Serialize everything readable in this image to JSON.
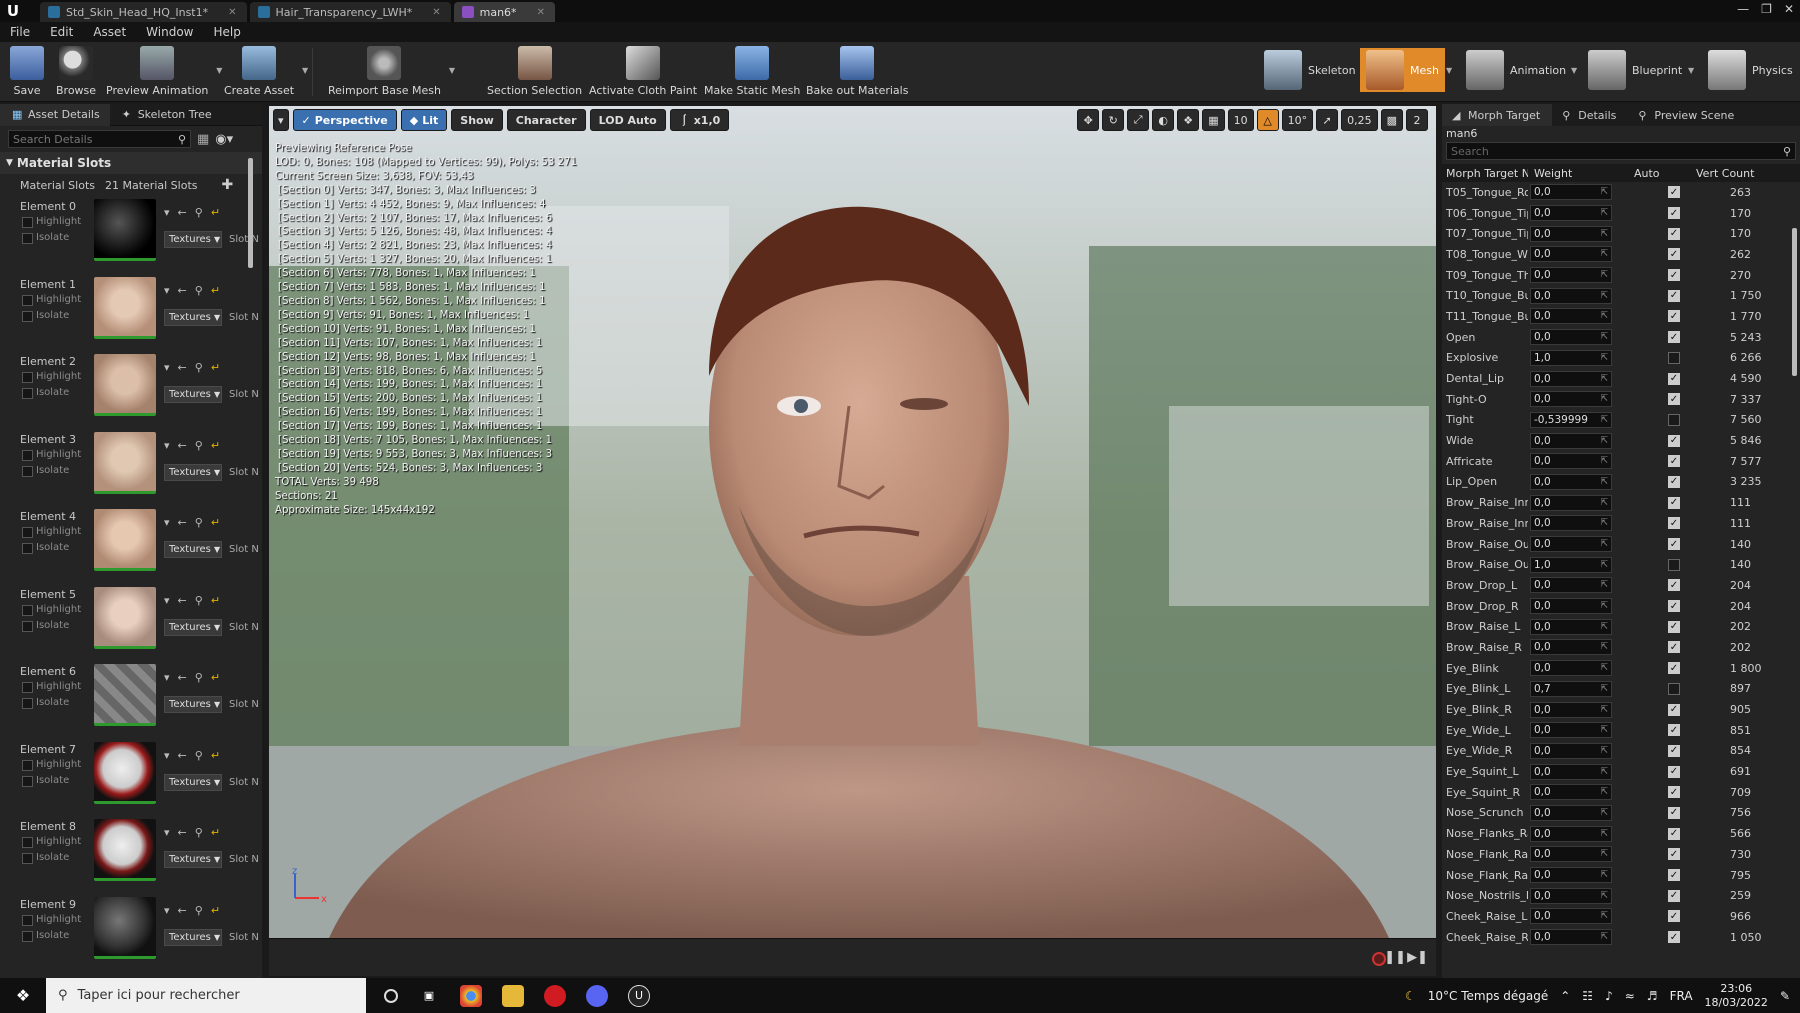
{
  "tabs": [
    {
      "label": "Std_Skin_Head_HQ_Inst1*",
      "active": false
    },
    {
      "label": "Hair_Transparency_LWH*",
      "active": false
    },
    {
      "label": "man6*",
      "active": true
    }
  ],
  "menu": [
    "File",
    "Edit",
    "Asset",
    "Window",
    "Help"
  ],
  "toolbar": {
    "save": "Save",
    "browse": "Browse",
    "preview_animation": "Preview Animation",
    "create_asset": "Create Asset",
    "reimport": "Reimport Base Mesh",
    "section_selection": "Section Selection",
    "cloth_paint": "Activate Cloth Paint",
    "make_static": "Make Static Mesh",
    "bake_out": "Bake out Materials"
  },
  "modes": {
    "skeleton": "Skeleton",
    "mesh": "Mesh",
    "animation": "Animation",
    "blueprint": "Blueprint",
    "physics": "Physics"
  },
  "left": {
    "tab_asset_details": "Asset Details",
    "tab_skeleton_tree": "Skeleton Tree",
    "search_placeholder": "Search Details",
    "section_title": "Material Slots",
    "slots_label": "Material Slots",
    "slots_count": "21 Material Slots",
    "highlight": "Highlight",
    "isolate": "Isolate",
    "textures": "Textures",
    "slot_name": "Slot N",
    "elements": [
      "Element 0",
      "Element 1",
      "Element 2",
      "Element 3",
      "Element 4",
      "Element 5",
      "Element 6",
      "Element 7",
      "Element 8",
      "Element 9"
    ]
  },
  "viewport": {
    "perspective": "Perspective",
    "lit": "Lit",
    "show": "Show",
    "character": "Character",
    "lod": "LOD Auto",
    "speed": "x1,0",
    "grid": "10",
    "angle": "10°",
    "scale": "0,25",
    "cams": "2",
    "stats": [
      "Previewing Reference Pose",
      "LOD: 0, Bones: 108 (Mapped to Vertices: 99), Polys: 53 271",
      "Current Screen Size: 3,638, FOV: 53,43",
      "[Section 0] Verts: 347, Bones: 3, Max Influences: 3",
      "[Section 1] Verts: 4 452, Bones: 9, Max Influences: 4",
      "[Section 2] Verts: 2 107, Bones: 17, Max Influences: 6",
      "[Section 3] Verts: 5 126, Bones: 48, Max Influences: 4",
      "[Section 4] Verts: 2 821, Bones: 23, Max Influences: 4",
      "[Section 5] Verts: 1 327, Bones: 20, Max Influences: 1",
      "[Section 6] Verts: 778, Bones: 1, Max Influences: 1",
      "[Section 7] Verts: 1 583, Bones: 1, Max Influences: 1",
      "[Section 8] Verts: 1 562, Bones: 1, Max Influences: 1",
      "[Section 9] Verts: 91, Bones: 1, Max Influences: 1",
      "[Section 10] Verts: 91, Bones: 1, Max Influences: 1",
      "[Section 11] Verts: 107, Bones: 1, Max Influences: 1",
      "[Section 12] Verts: 98, Bones: 1, Max Influences: 1",
      "[Section 13] Verts: 818, Bones: 6, Max Influences: 5",
      "[Section 14] Verts: 199, Bones: 1, Max Influences: 1",
      "[Section 15] Verts: 200, Bones: 1, Max Influences: 1",
      "[Section 16] Verts: 199, Bones: 1, Max Influences: 1",
      "[Section 17] Verts: 199, Bones: 1, Max Influences: 1",
      "[Section 18] Verts: 7 105, Bones: 1, Max Influences: 1",
      "[Section 19] Verts: 9 553, Bones: 3, Max Influences: 3",
      "[Section 20] Verts: 524, Bones: 3, Max Influences: 3",
      "TOTAL Verts: 39 498",
      "Sections: 21",
      "Approximate Size: 145x44x192"
    ]
  },
  "right": {
    "tab_morph": "Morph Target",
    "tab_details": "Details",
    "tab_preview": "Preview Scene",
    "asset_name": "man6",
    "search_placeholder": "Search",
    "col_name": "Morph Target N",
    "col_weight": "Weight",
    "col_auto": "Auto",
    "col_vert": "Vert Count",
    "rows": [
      {
        "name": "T05_Tongue_Ro",
        "weight": "0,0",
        "auto": true,
        "verts": "263"
      },
      {
        "name": "T06_Tongue_Tip",
        "weight": "0,0",
        "auto": true,
        "verts": "170"
      },
      {
        "name": "T07_Tongue_Tip",
        "weight": "0,0",
        "auto": true,
        "verts": "170"
      },
      {
        "name": "T08_Tongue_Wi",
        "weight": "0,0",
        "auto": true,
        "verts": "262"
      },
      {
        "name": "T09_Tongue_Th",
        "weight": "0,0",
        "auto": true,
        "verts": "270"
      },
      {
        "name": "T10_Tongue_Bu",
        "weight": "0,0",
        "auto": true,
        "verts": "1 750"
      },
      {
        "name": "T11_Tongue_Bu",
        "weight": "0,0",
        "auto": true,
        "verts": "1 770"
      },
      {
        "name": "Open",
        "weight": "0,0",
        "auto": true,
        "verts": "5 243"
      },
      {
        "name": "Explosive",
        "weight": "1,0",
        "auto": false,
        "verts": "6 266"
      },
      {
        "name": "Dental_Lip",
        "weight": "0,0",
        "auto": true,
        "verts": "4 590"
      },
      {
        "name": "Tight-O",
        "weight": "0,0",
        "auto": true,
        "verts": "7 337"
      },
      {
        "name": "Tight",
        "weight": "-0,539999",
        "auto": false,
        "verts": "7 560"
      },
      {
        "name": "Wide",
        "weight": "0,0",
        "auto": true,
        "verts": "5 846"
      },
      {
        "name": "Affricate",
        "weight": "0,0",
        "auto": true,
        "verts": "7 577"
      },
      {
        "name": "Lip_Open",
        "weight": "0,0",
        "auto": true,
        "verts": "3 235"
      },
      {
        "name": "Brow_Raise_Inn",
        "weight": "0,0",
        "auto": true,
        "verts": "111"
      },
      {
        "name": "Brow_Raise_Inn",
        "weight": "0,0",
        "auto": true,
        "verts": "111"
      },
      {
        "name": "Brow_Raise_Out",
        "weight": "0,0",
        "auto": true,
        "verts": "140"
      },
      {
        "name": "Brow_Raise_Out",
        "weight": "1,0",
        "auto": false,
        "verts": "140"
      },
      {
        "name": "Brow_Drop_L",
        "weight": "0,0",
        "auto": true,
        "verts": "204"
      },
      {
        "name": "Brow_Drop_R",
        "weight": "0,0",
        "auto": true,
        "verts": "204"
      },
      {
        "name": "Brow_Raise_L",
        "weight": "0,0",
        "auto": true,
        "verts": "202"
      },
      {
        "name": "Brow_Raise_R",
        "weight": "0,0",
        "auto": true,
        "verts": "202"
      },
      {
        "name": "Eye_Blink",
        "weight": "0,0",
        "auto": true,
        "verts": "1 800"
      },
      {
        "name": "Eye_Blink_L",
        "weight": "0,7",
        "auto": false,
        "verts": "897"
      },
      {
        "name": "Eye_Blink_R",
        "weight": "0,0",
        "auto": true,
        "verts": "905"
      },
      {
        "name": "Eye_Wide_L",
        "weight": "0,0",
        "auto": true,
        "verts": "851"
      },
      {
        "name": "Eye_Wide_R",
        "weight": "0,0",
        "auto": true,
        "verts": "854"
      },
      {
        "name": "Eye_Squint_L",
        "weight": "0,0",
        "auto": true,
        "verts": "691"
      },
      {
        "name": "Eye_Squint_R",
        "weight": "0,0",
        "auto": true,
        "verts": "709"
      },
      {
        "name": "Nose_Scrunch",
        "weight": "0,0",
        "auto": true,
        "verts": "756"
      },
      {
        "name": "Nose_Flanks_Ra",
        "weight": "0,0",
        "auto": true,
        "verts": "566"
      },
      {
        "name": "Nose_Flank_Rai",
        "weight": "0,0",
        "auto": true,
        "verts": "730"
      },
      {
        "name": "Nose_Flank_Rai",
        "weight": "0,0",
        "auto": true,
        "verts": "795"
      },
      {
        "name": "Nose_Nostrils_F",
        "weight": "0,0",
        "auto": true,
        "verts": "259"
      },
      {
        "name": "Cheek_Raise_L",
        "weight": "0,0",
        "auto": true,
        "verts": "966"
      },
      {
        "name": "Cheek_Raise_R",
        "weight": "0,0",
        "auto": true,
        "verts": "1 050"
      }
    ]
  },
  "taskbar": {
    "search": "Taper ici pour rechercher",
    "weather": "10°C  Temps dégagé",
    "lang": "FRA",
    "time": "23:06",
    "date": "18/03/2022"
  }
}
